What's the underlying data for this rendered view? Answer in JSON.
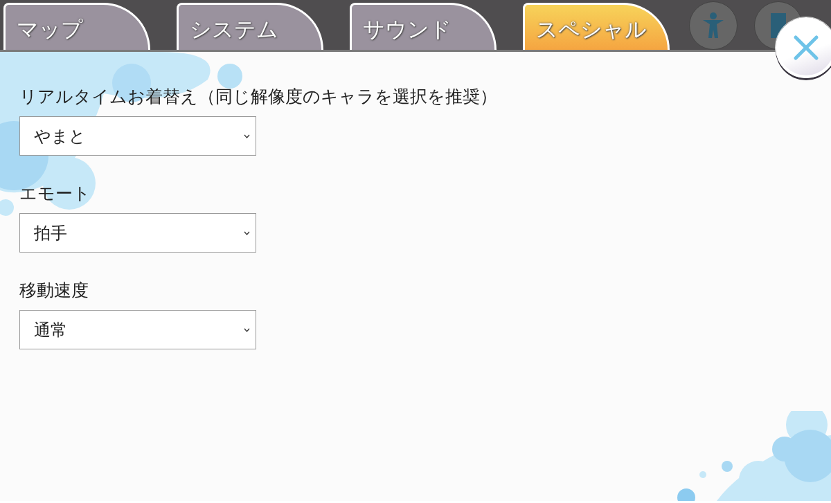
{
  "tabs": [
    {
      "label": "マップ",
      "selected": false
    },
    {
      "label": "システム",
      "selected": false
    },
    {
      "label": "サウンド",
      "selected": false
    },
    {
      "label": "スペシャル",
      "selected": true
    }
  ],
  "fields": [
    {
      "label": "リアルタイムお着替え（同じ解像度のキャラを選択を推奨）",
      "value": "やまと"
    },
    {
      "label": "エモート",
      "value": "拍手"
    },
    {
      "label": "移動速度",
      "value": "通常"
    }
  ]
}
